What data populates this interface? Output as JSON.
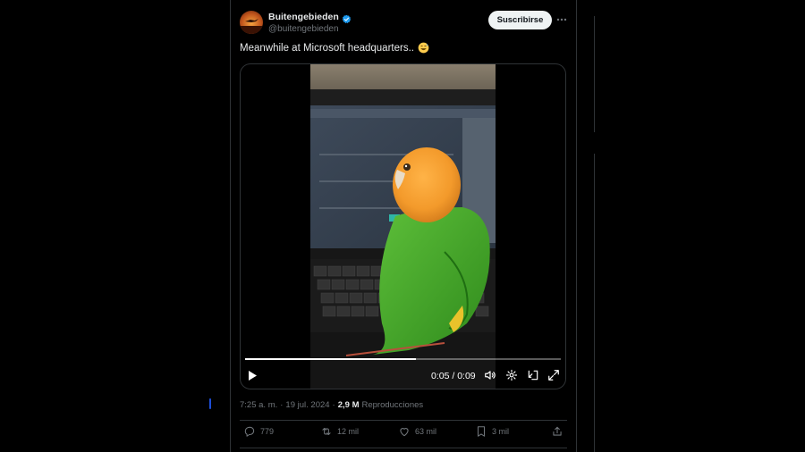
{
  "author": {
    "display_name": "Buitengebieden",
    "handle": "@buitengebieden",
    "verified_icon": "verified-badge-icon",
    "avatar_icon": "avatar-sunset-bird"
  },
  "header": {
    "subscribe_label": "Suscribirse",
    "more_icon": "more-horizontal-icon"
  },
  "tweet": {
    "text": "Meanwhile at Microsoft headquarters..",
    "emoji": "grinning-sweat-emoji"
  },
  "video": {
    "current_time": "0:05",
    "duration": "0:09",
    "time_display": "0:05 / 0:09",
    "progress_fraction": 0.54,
    "controls": [
      "play-icon",
      "volume-icon",
      "settings-gear-icon",
      "pip-icon",
      "fullscreen-icon"
    ]
  },
  "meta": {
    "time": "7:25 a. m.",
    "separator": "·",
    "date": "19 jul. 2024",
    "views_count": "2,9 M",
    "views_label": "Reproducciones"
  },
  "actions": {
    "replies": "779",
    "reposts": "12 mil",
    "likes": "63 mil",
    "bookmarks": "3 mil"
  },
  "colors": {
    "background": "#000000",
    "border": "#2f3336",
    "text_primary": "#e7e9ea",
    "text_secondary": "#71767b",
    "verified": "#1d9bf0",
    "subscribe_bg": "#eff3f4"
  }
}
